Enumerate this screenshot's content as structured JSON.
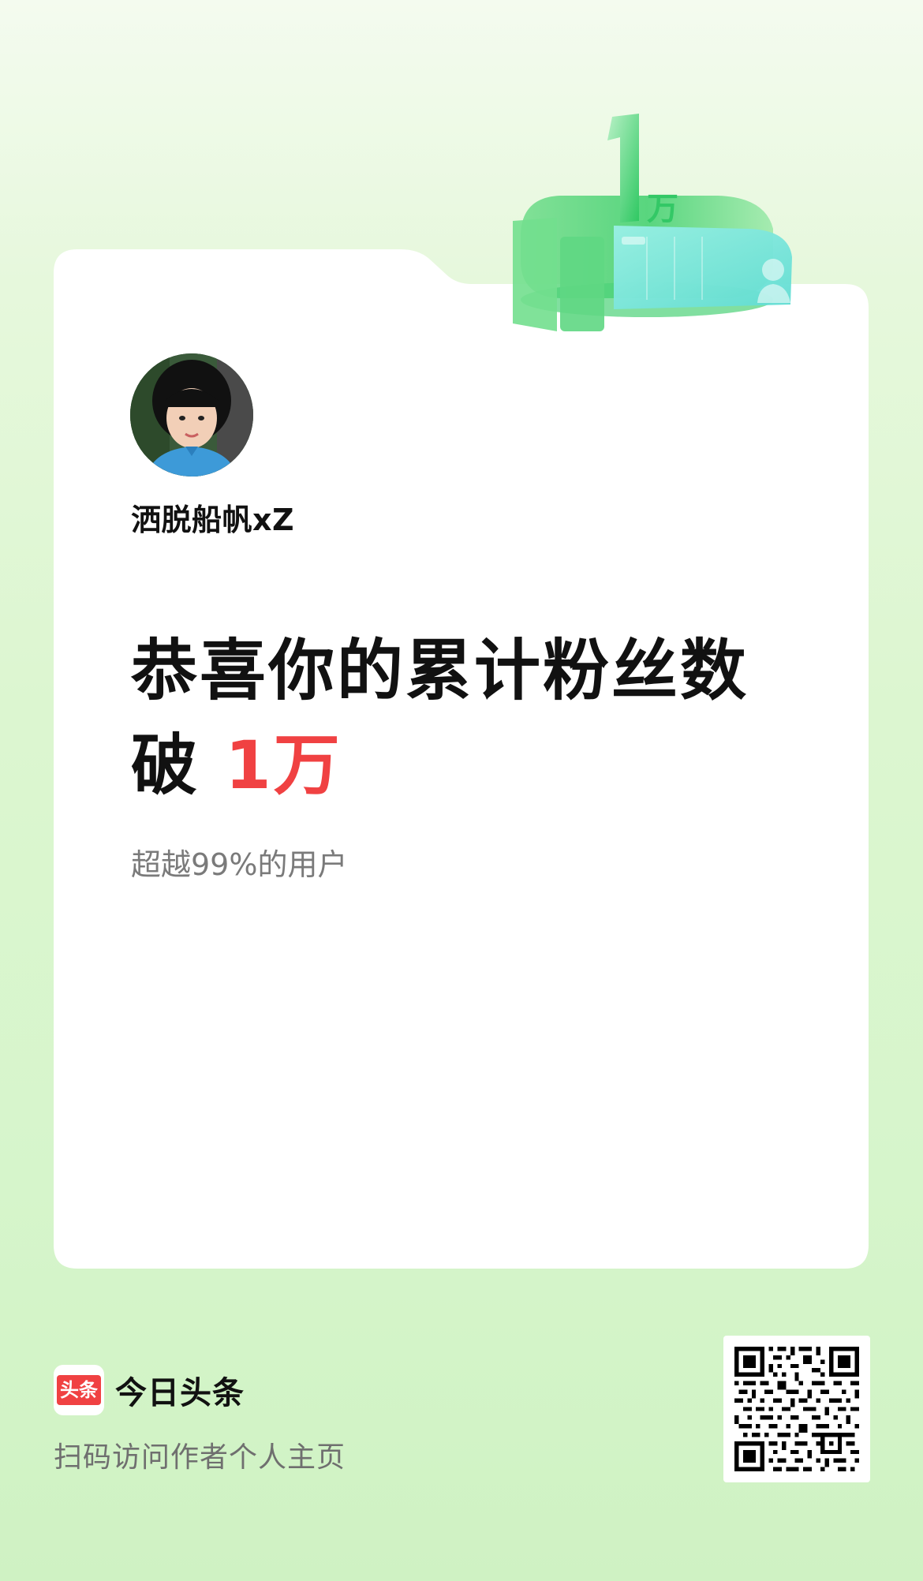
{
  "badge": {
    "number": "1",
    "unit": "万"
  },
  "profile": {
    "username": "洒脱船帆xZ"
  },
  "headline": {
    "line1": "恭喜你的累计粉丝数",
    "line2_prefix": "破 ",
    "line2_highlight": "1万"
  },
  "subtext": "超越99%的用户",
  "footer": {
    "brand_logo_text": "头条",
    "brand_name": "今日头条",
    "scan_hint": "扫码访问作者个人主页"
  },
  "colors": {
    "accent_red": "#f04142",
    "badge_green": "#3ed16a",
    "badge_cyan": "#7ee8e2",
    "background_green": "#dcf6d0"
  }
}
